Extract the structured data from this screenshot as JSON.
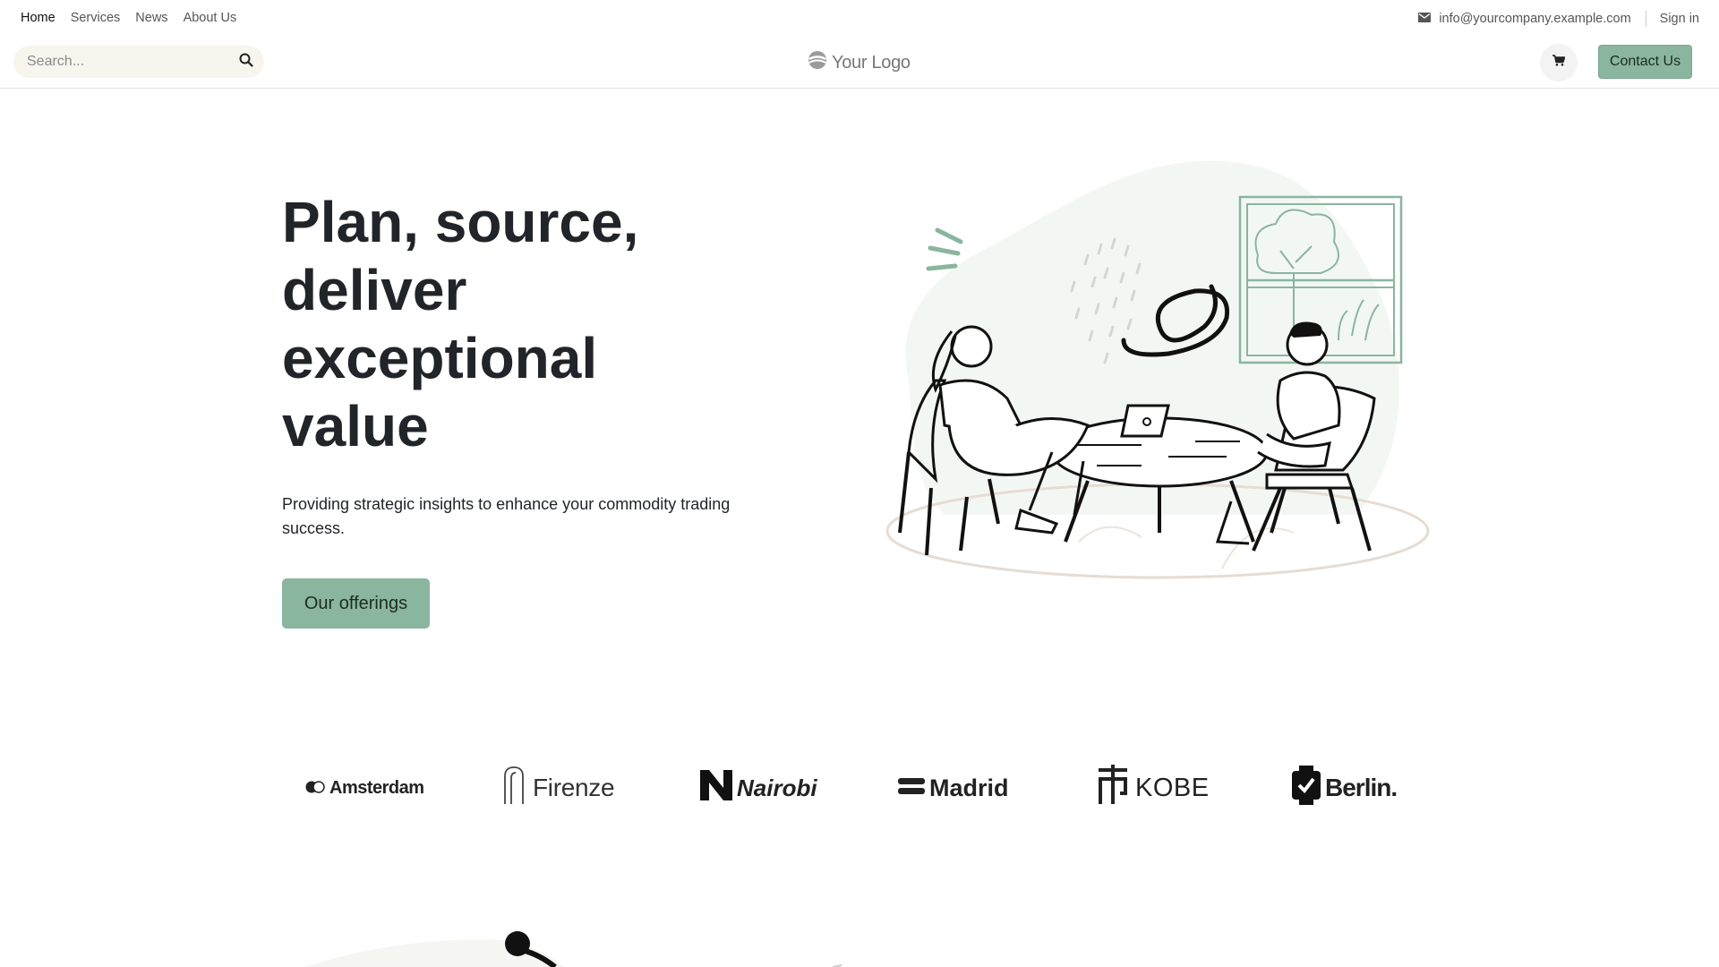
{
  "topbar": {
    "nav": [
      {
        "label": "Home",
        "active": true
      },
      {
        "label": "Services",
        "active": false
      },
      {
        "label": "News",
        "active": false
      },
      {
        "label": "About Us",
        "active": false
      }
    ],
    "email": "info@yourcompany.example.com",
    "signin": "Sign in",
    "icons": {
      "email": "envelope-icon"
    }
  },
  "header": {
    "search_placeholder": "Search...",
    "logo_text": "Your Logo",
    "contact_label": "Contact Us",
    "icons": {
      "search": "search-icon",
      "cart": "cart-icon"
    }
  },
  "hero": {
    "title": "Plan, source, deliver exceptional value",
    "subtitle": "Providing strategic insights to enhance your commodity trading success.",
    "button": "Our offerings"
  },
  "cities": [
    "Amsterdam",
    "Firenze",
    "Nairobi",
    "Madrid",
    "KOBE",
    "Berlin."
  ],
  "colors": {
    "accent": "#8ab59e",
    "search_bg": "#f8f5ee",
    "text": "#212529"
  }
}
